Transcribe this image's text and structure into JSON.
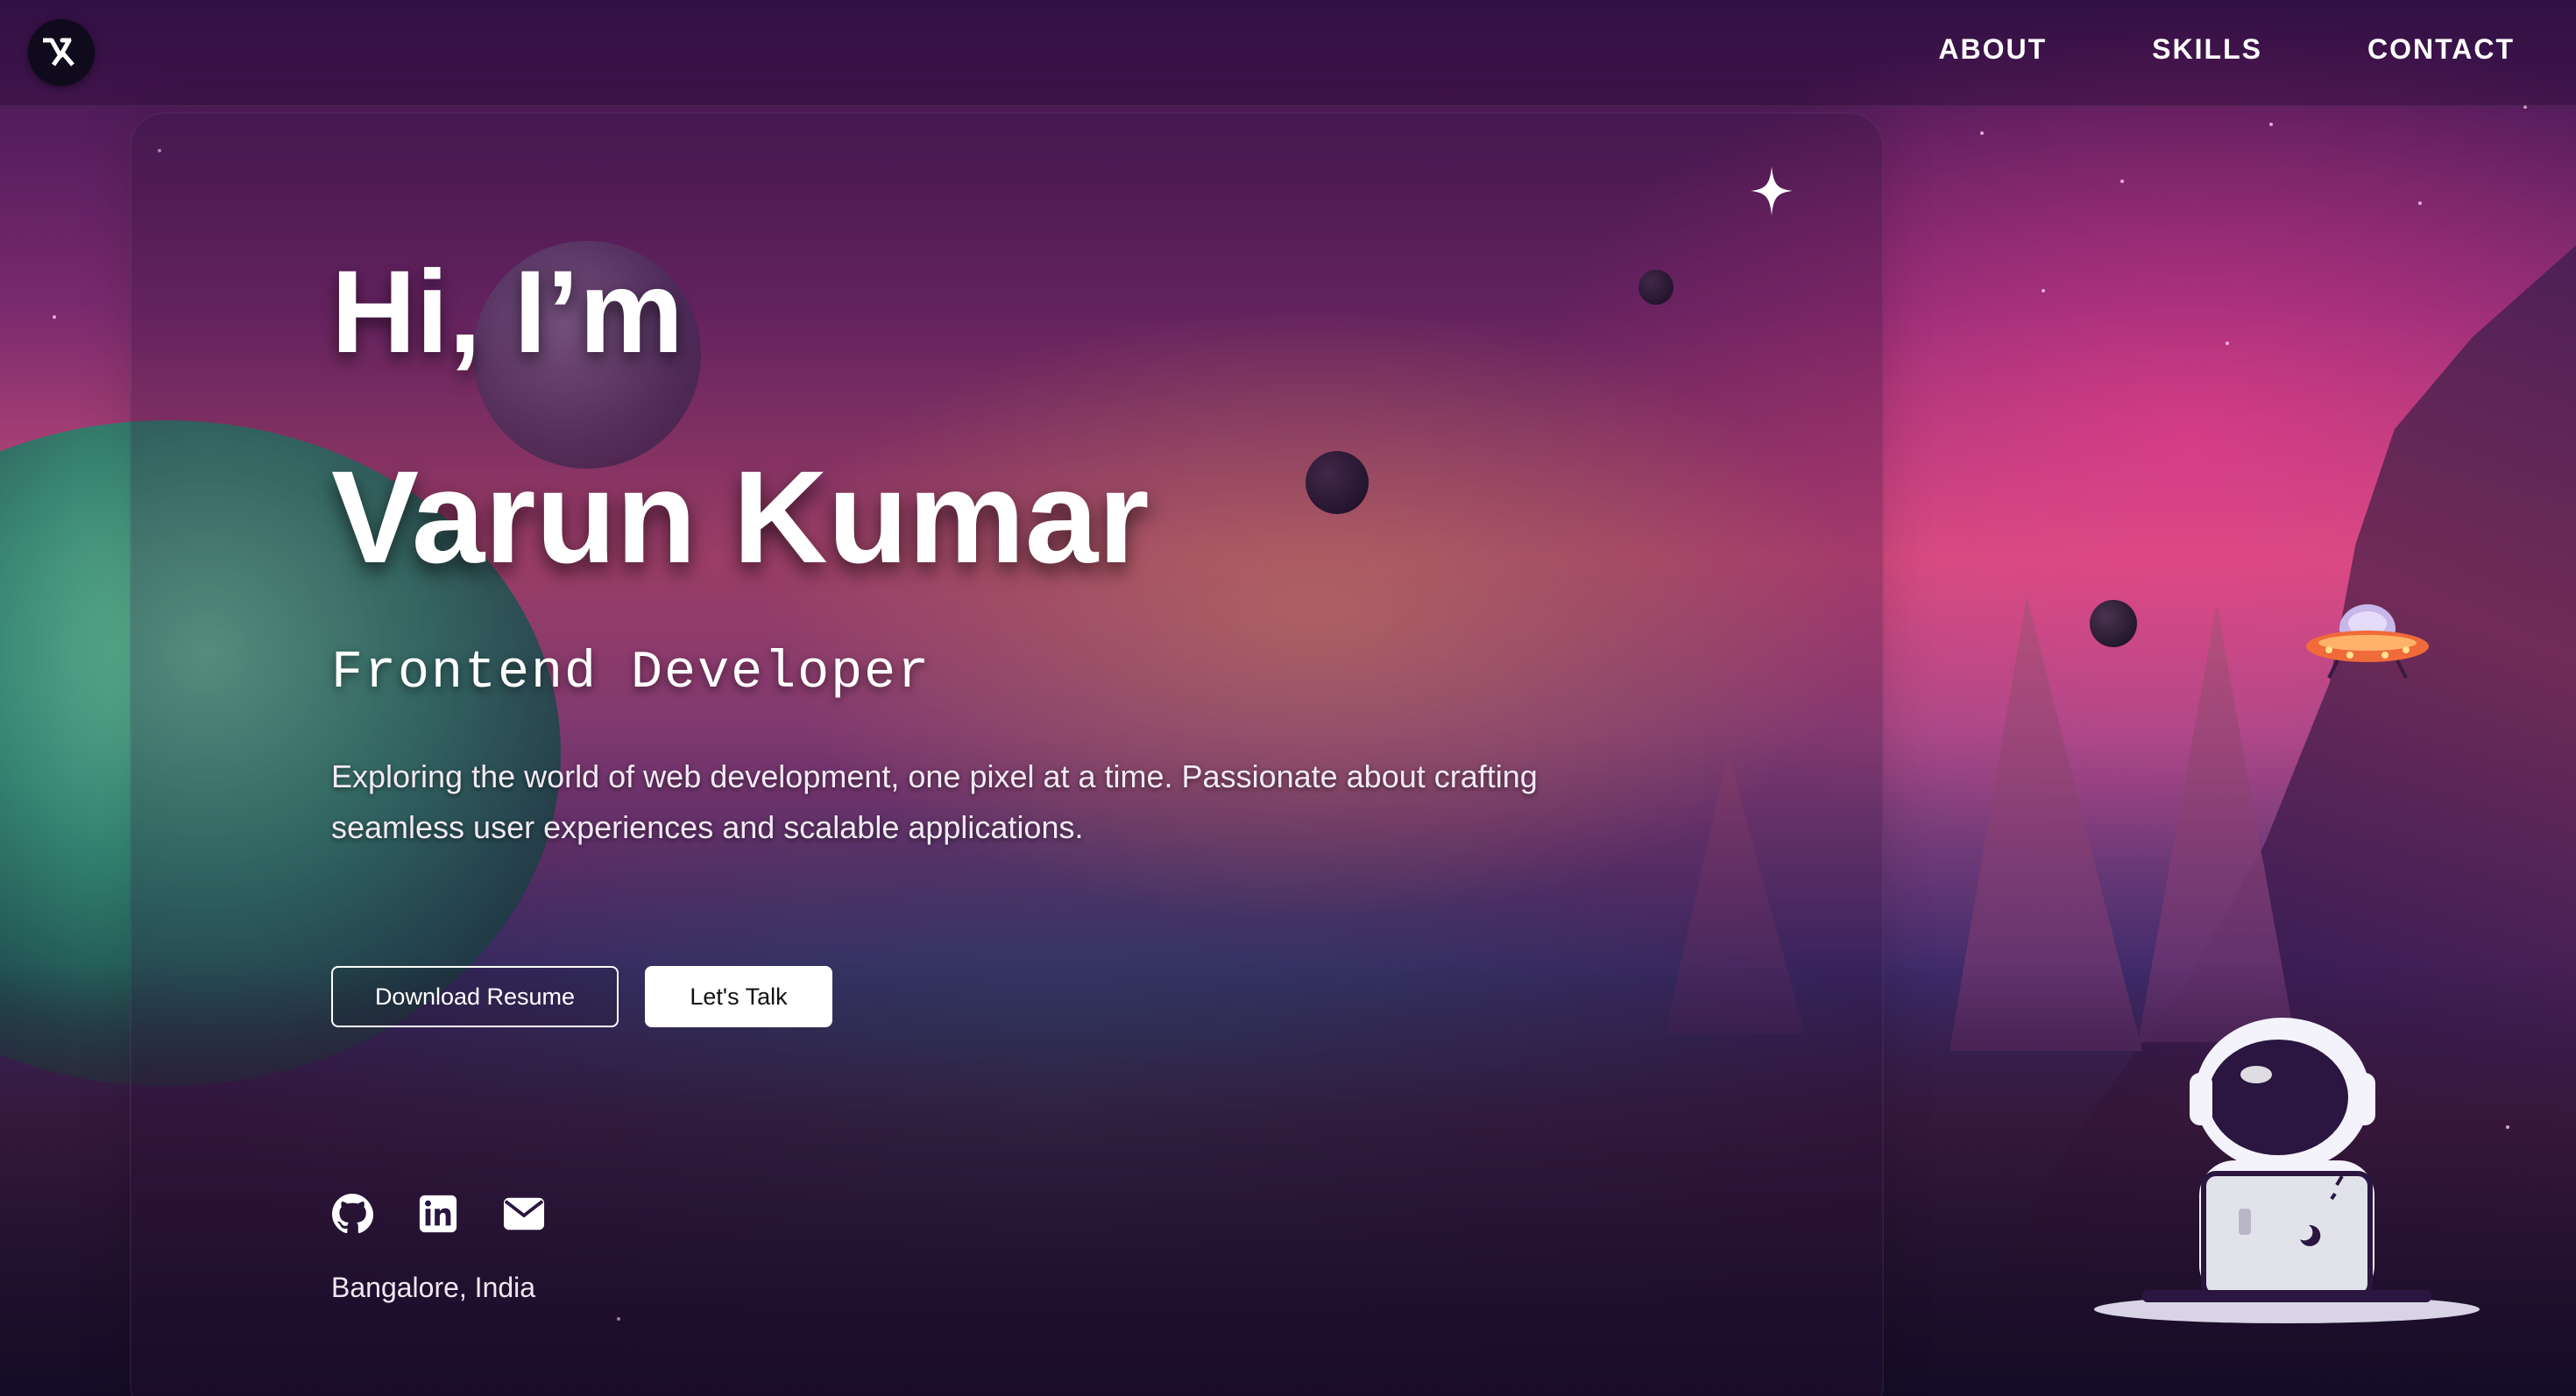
{
  "header": {
    "logo_text": "VK",
    "nav": [
      {
        "label": "ABOUT"
      },
      {
        "label": "SKILLS"
      },
      {
        "label": "CONTACT"
      }
    ]
  },
  "hero": {
    "greeting": "Hi, I’m",
    "name": "Varun Kumar",
    "role": "Frontend Developer",
    "bio": "Exploring the world of web development, one pixel at a time. Passionate about crafting seamless user experiences and scalable applications.",
    "buttons": {
      "download": "Download Resume",
      "talk": "Let's Talk"
    },
    "socials": [
      {
        "icon": "github-icon"
      },
      {
        "icon": "linkedin-icon"
      },
      {
        "icon": "mail-icon"
      }
    ],
    "location": "Bangalore, India"
  },
  "theme": {
    "accent": "#ffffff",
    "background_dark": "#1a0b2e",
    "sky_pink": "#c8507a",
    "planet_green": "#2f8d73"
  }
}
